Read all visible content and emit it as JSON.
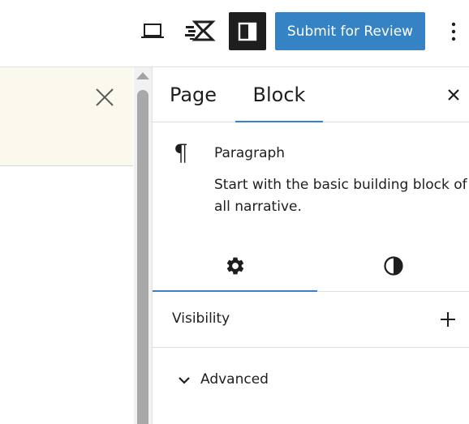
{
  "toolbar": {
    "preview_icon": "laptop-icon",
    "performance_icon": "speed-lightning-icon",
    "settings_toggle_icon": "sidebar-toggle-icon",
    "submit_label": "Submit for Review",
    "more_icon": "vertical-ellipsis-icon"
  },
  "notice": {
    "close_icon": "close-icon"
  },
  "sidebar": {
    "tabs": [
      {
        "label": "Page",
        "active": false
      },
      {
        "label": "Block",
        "active": true
      }
    ],
    "close_icon": "close-icon",
    "block": {
      "icon": "¶",
      "title": "Paragraph",
      "description": "Start with the basic building block of all narrative."
    },
    "subtabs": [
      {
        "name": "settings",
        "icon": "gear-icon",
        "active": true
      },
      {
        "name": "styles",
        "icon": "half-circle-contrast-icon",
        "active": false
      }
    ],
    "visibility": {
      "label": "Visibility",
      "action_icon": "plus-icon"
    },
    "advanced": {
      "label": "Advanced",
      "icon": "chevron-down-icon",
      "expanded": false
    }
  },
  "colors": {
    "accent": "#3582c4",
    "dark": "#1e1e1e",
    "notice_bg": "#fbf8ee",
    "border": "#e0e0e0",
    "scrollbar_thumb": "#a8a8a8"
  }
}
